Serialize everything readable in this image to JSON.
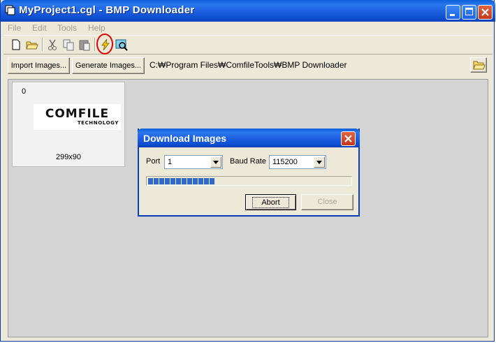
{
  "window": {
    "title": "MyProject1.cgl - BMP Downloader"
  },
  "menu": [
    "File",
    "Edit",
    "Tools",
    "Help"
  ],
  "toolbar": {
    "icons": [
      "new-file-icon",
      "open-folder-icon",
      "cut-icon",
      "copy-icon",
      "paste-icon",
      "download-lightning-icon",
      "preview-icon"
    ],
    "highlighted": "download-lightning-icon"
  },
  "pathbar": {
    "import_label": "Import Images...",
    "generate_label": "Generate Images...",
    "path": "C:₩Program Files₩ComfileTools₩BMP Downloader"
  },
  "image_list": [
    {
      "index": "0",
      "logo_main": "COMFILE",
      "logo_sub": "TECHNOLOGY",
      "size": "299x90"
    }
  ],
  "dialog": {
    "title": "Download Images",
    "port_label": "Port",
    "port_value": "1",
    "baud_label": "Baud Rate",
    "baud_value": "115200",
    "progress_segments": 12,
    "abort_label": "Abort",
    "close_label": "Close"
  },
  "colors": {
    "titlebar": "#1c5ee0",
    "progress": "#3169c6",
    "highlight_circle": "#e00000"
  }
}
